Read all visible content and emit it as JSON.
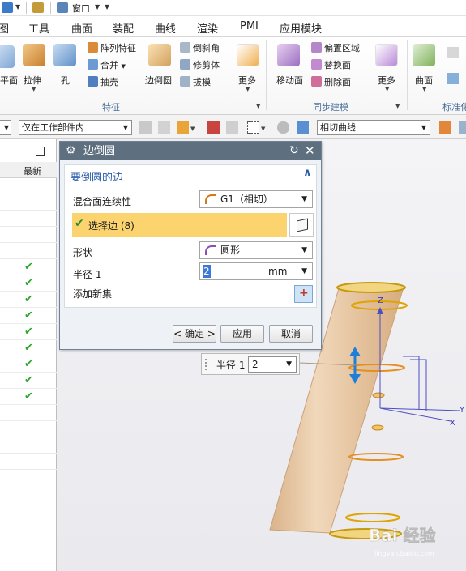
{
  "window": {
    "menu_window_label": "窗口"
  },
  "tabs": [
    "图",
    "工具",
    "曲面",
    "装配",
    "曲线",
    "渲染",
    "PMI",
    "应用模块"
  ],
  "ribbon": {
    "feature_group": {
      "label": "特征",
      "left_cut_label": "平面",
      "extrude_label": "拉伸",
      "hole_label": "孔",
      "small_items": [
        "阵列特征",
        "合并",
        "抽壳"
      ],
      "edge_blend_label": "边倒圆",
      "small_items2": [
        "倒斜角",
        "修剪体",
        "拔模"
      ],
      "more_label": "更多"
    },
    "sync_group": {
      "label": "同步建模",
      "move_face_label": "移动面",
      "small_items": [
        "偏置区域",
        "替换面",
        "删除面"
      ],
      "more_label": "更多"
    },
    "surface_group": {
      "label": "标准化",
      "surface_label": "曲面"
    }
  },
  "selection_bar": {
    "scope_value": "仅在工作部件内",
    "curve_rule_value": "相切曲线"
  },
  "navigator": {
    "column_latest": "最新",
    "checked_rows": 9
  },
  "dialog": {
    "title": "边倒圆",
    "section_title": "要倒圆的边",
    "continuity_label": "混合面连续性",
    "continuity_value": "G1（相切）",
    "select_edge_label": "选择边 (8)",
    "shape_label": "形状",
    "shape_value": "圆形",
    "radius_label": "半径 1",
    "radius_value": "2",
    "radius_unit": "mm",
    "add_set_label": "添加新集",
    "ok_label": "< 确定 >",
    "apply_label": "应用",
    "cancel_label": "取消"
  },
  "onscreen_input": {
    "label": "半径 1",
    "value": "2"
  },
  "viewport": {
    "axis_z": "Z",
    "axis_y": "Y",
    "axis_x": "X",
    "watermark": "Bai 经验",
    "watermark_sub": "jingyan.baidu.com"
  },
  "colors": {
    "dialog_title_bg": "#5e6f80",
    "highlight_row": "#fbd36f",
    "section_title": "#2b5fab",
    "cylinder": "#e8c9a3",
    "check_green": "#2aa52a"
  }
}
